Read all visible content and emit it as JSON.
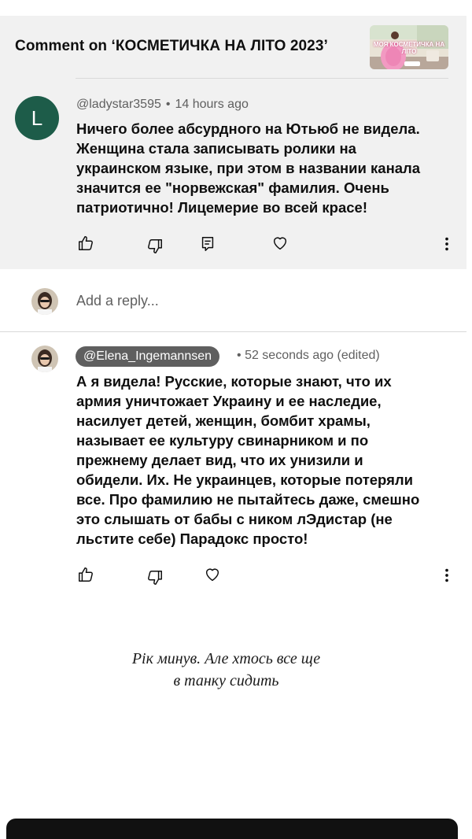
{
  "header": {
    "title": "Comment on ‘КОСМЕТИЧКА НА ЛІТО 2023’",
    "thumbnail_text": "МОЯ КОСМЕТИЧКА НА ЛІТО"
  },
  "comment": {
    "avatar_letter": "L",
    "author": "@ladystar3595",
    "time": "14 hours ago",
    "text_lines": [
      "Ничего более абсурдного на Ютьюб не видела.",
      "Женщина стала записывать ролики на",
      "украинском языке, при этом в названии канала",
      "значится ее \"норвежская\" фамилия. Очень",
      "патриотично! Лицемерие во всей красе!"
    ]
  },
  "reply_box": {
    "placeholder": "Add a reply..."
  },
  "reply": {
    "author": "@Elena_Ingemannsen",
    "time": "52 seconds ago (edited)",
    "text_lines": [
      "А я видела! Русские, которые знают, что их",
      "армия уничтожает Украину и ее наследие,",
      "насилует детей, женщин, бомбит храмы,",
      "называет ее культуру свинарником и по",
      "прежнему делает вид, что их унизили и",
      "обидели. Их. Не украинцев, которые потеряли",
      "все. Про фамилию не пытайтесь  даже, смешно",
      "это  слышать от бабы с ником лЭдистар (не",
      "льстите себе) Парадокс просто!"
    ]
  },
  "caption": {
    "line1": "Рік минув. Але хтось все ще",
    "line2": "в танку сидить"
  },
  "colors": {
    "panel_bg": "#f1f1f1",
    "avatar_bg": "#1d5c49",
    "badge_bg": "#5f5f5f",
    "meta_text": "#606060"
  },
  "icons": [
    "like-icon",
    "dislike-icon",
    "reply-icon",
    "heart-icon",
    "more-options-icon"
  ]
}
